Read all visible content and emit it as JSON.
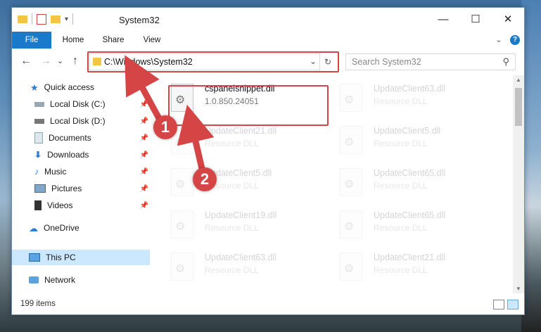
{
  "window": {
    "title": "System32",
    "controls": {
      "minimize": "—",
      "maximize": "☐",
      "close": "✕"
    }
  },
  "ribbon": {
    "tabs": [
      {
        "label": "File"
      },
      {
        "label": "Home"
      },
      {
        "label": "Share"
      },
      {
        "label": "View"
      }
    ],
    "expand": "⌄",
    "help": "?"
  },
  "nav": {
    "back": "←",
    "forward": "→",
    "recent": "⌄",
    "up": "↑",
    "address": "C:\\Windows\\System32",
    "address_dropdown": "⌄",
    "refresh": "↻",
    "search_placeholder": "Search System32"
  },
  "sidebar": {
    "items": [
      {
        "label": "Quick access"
      },
      {
        "label": "Local Disk (C:)"
      },
      {
        "label": "Local Disk (D:)"
      },
      {
        "label": "Documents"
      },
      {
        "label": "Downloads"
      },
      {
        "label": "Music"
      },
      {
        "label": "Pictures"
      },
      {
        "label": "Videos"
      },
      {
        "label": "OneDrive"
      },
      {
        "label": "This PC"
      },
      {
        "label": "Network"
      }
    ]
  },
  "files": [
    {
      "name": "cspanelsnippet.dll",
      "type": "1.0.850.24051"
    },
    {
      "name": "UpdateClient63.dll",
      "type": "Resource DLL"
    },
    {
      "name": "UpdateClient21.dll",
      "type": "Resource DLL"
    },
    {
      "name": "UpdateClient5.dll",
      "type": "Resource DLL"
    },
    {
      "name": "UpdateClient5.dll",
      "type": "Resource DLL"
    },
    {
      "name": "UpdateClient65.dll",
      "type": "Resource DLL"
    },
    {
      "name": "UpdateClient19.dll",
      "type": "Resource DLL"
    },
    {
      "name": "UpdateClient65.dll",
      "type": "Resource DLL"
    },
    {
      "name": "UpdateClient63.dll",
      "type": "Resource DLL"
    },
    {
      "name": "UpdateClient21.dll",
      "type": "Resource DLL"
    }
  ],
  "status": {
    "count": "199 items"
  },
  "annotations": {
    "one": "1",
    "two": "2"
  },
  "colors": {
    "accent": "#1979ca",
    "highlight": "#d64545",
    "selected": "#cce8ff"
  }
}
